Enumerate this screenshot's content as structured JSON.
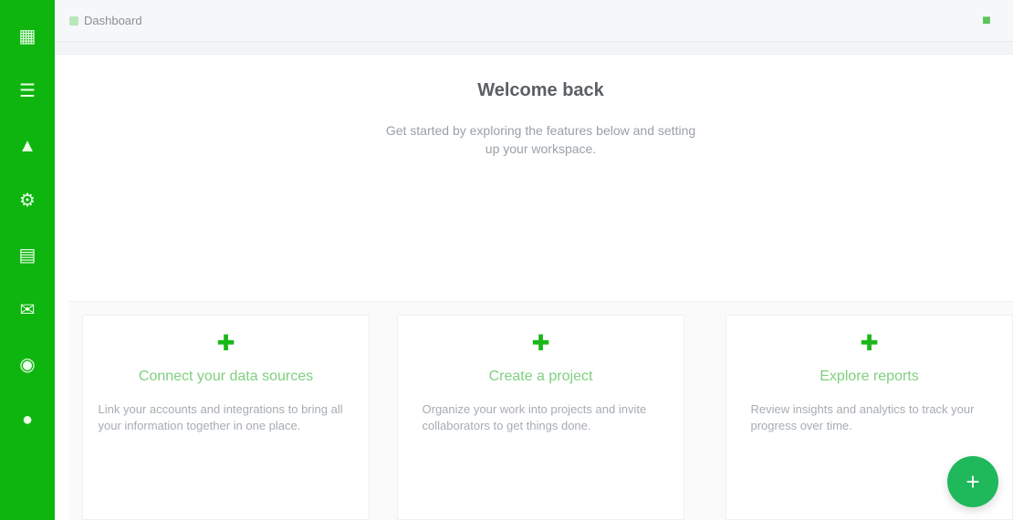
{
  "sidebar": {
    "icons": [
      "grid-icon",
      "list-icon",
      "chart-icon",
      "gear-icon",
      "folder-icon",
      "message-icon",
      "bell-icon",
      "user-icon",
      "help-icon"
    ]
  },
  "topbar": {
    "breadcrumb": "Dashboard",
    "right_icon": "settings-icon"
  },
  "hero": {
    "title": "Welcome back",
    "description": "Get started by exploring the features below and setting up your workspace."
  },
  "cards": [
    {
      "title": "Connect your data sources",
      "text": "Link your accounts and integrations to bring all your information together in one place."
    },
    {
      "title": "Create a project",
      "text": "Organize your work into projects and invite collaborators to get things done."
    },
    {
      "title": "Explore reports",
      "text": "Review insights and analytics to track your progress over time."
    }
  ],
  "fab": {
    "label": "+"
  }
}
